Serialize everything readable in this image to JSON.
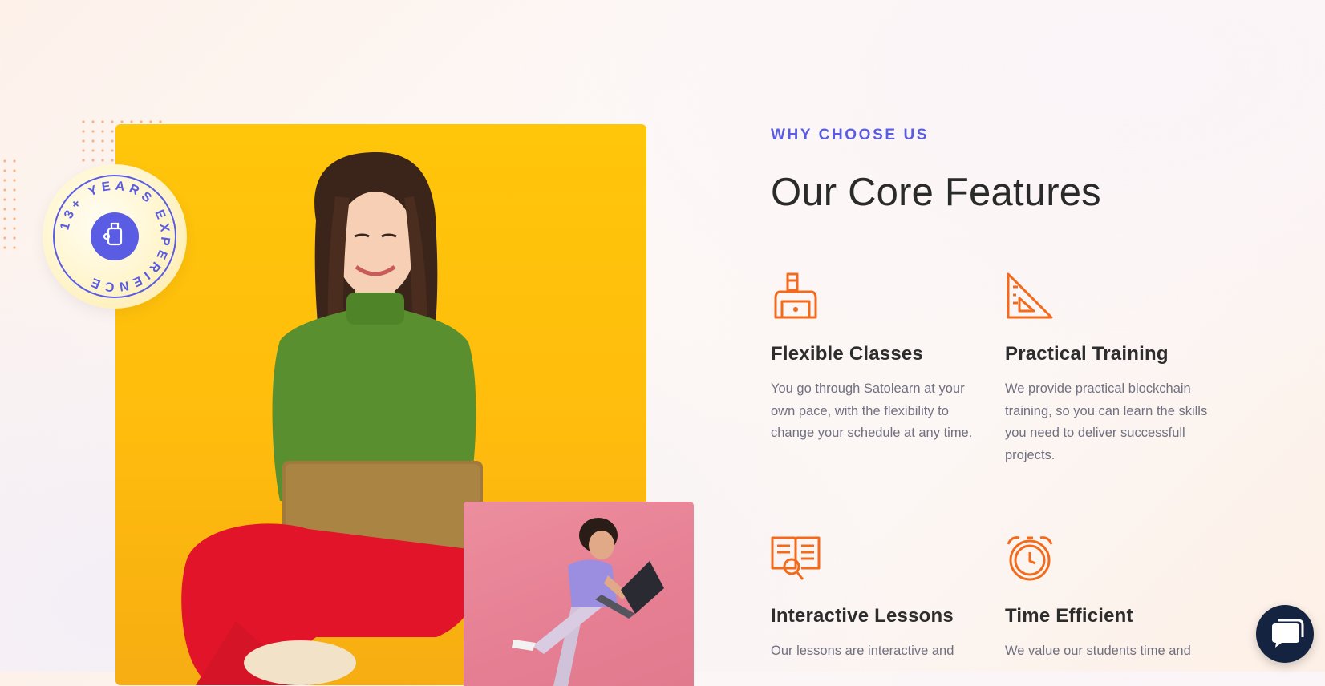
{
  "section": {
    "eyebrow": "WHY CHOOSE US",
    "title": "Our Core Features"
  },
  "badge": {
    "circular_text": "13+ YEARS EXPERIENCE"
  },
  "features": [
    {
      "title": "Flexible Classes",
      "description": "You go through Satolearn at your own pace, with the flexibility to change your schedule at any time.",
      "icon": "student-laptop-icon"
    },
    {
      "title": "Practical Training",
      "description": "We provide practical blockchain training, so you can learn the skills you need to deliver successfull projects.",
      "icon": "set-square-icon"
    },
    {
      "title": "Interactive Lessons",
      "description": "Our lessons are interactive and",
      "icon": "book-search-icon"
    },
    {
      "title": "Time Efficient",
      "description": "We value our students time and",
      "icon": "alarm-clock-icon"
    }
  ],
  "colors": {
    "accent": "#5a5ce4",
    "icon": "#f26b1d",
    "photo_main_bg": "#ffc20c",
    "photo_small_bg": "#e8879a",
    "chat_button": "#14233f"
  },
  "images": {
    "main": "woman-with-laptop-photo",
    "small": "man-jumping-with-laptop-photo"
  },
  "chat": {
    "icon": "chat-icon"
  }
}
